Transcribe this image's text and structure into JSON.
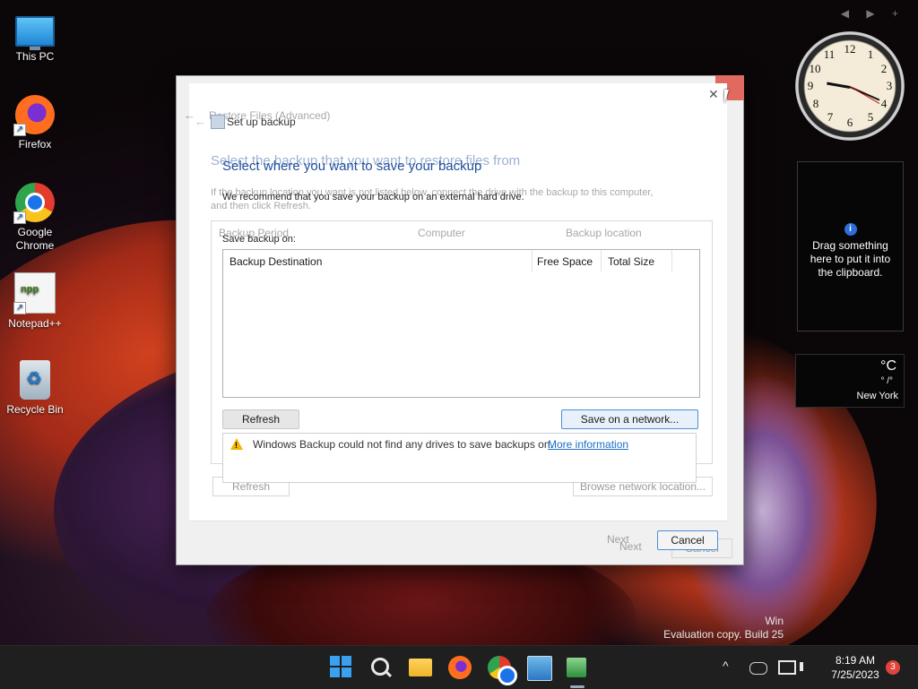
{
  "desktop": {
    "icons": [
      {
        "label": "This PC"
      },
      {
        "label": "Firefox"
      },
      {
        "label": "Google Chrome"
      },
      {
        "label": "Notepad++"
      },
      {
        "label": "Recycle Bin"
      }
    ],
    "gadget_nav": "◀ ▶ +"
  },
  "clock": {
    "numbers": [
      "12",
      "1",
      "2",
      "3",
      "4",
      "5",
      "6",
      "7",
      "8",
      "9",
      "10",
      "11"
    ]
  },
  "clipboard_gadget": {
    "info_glyph": "i",
    "message": "Drag something here to put it into the clipboard."
  },
  "weather_gadget": {
    "unit": "°C",
    "range": "° /°",
    "city": "New York"
  },
  "watermark": {
    "line1": "Win",
    "line2": "Evaluation copy. Build 25"
  },
  "ghost_window": {
    "title": "Restore Files (Advanced)",
    "heading": "Select the backup that you want to restore files from",
    "description": "If the backup location you want is not listed below, connect the drive with the backup to this computer, and then click Refresh.",
    "columns": [
      "Backup Period",
      "Computer",
      "Backup location"
    ],
    "refresh_label": "Refresh",
    "browse_label": "Browse network location...",
    "next_label": "Next",
    "cancel_label": "Cancel"
  },
  "dialog": {
    "title": "Set up backup",
    "heading": "Select where you want to save your backup",
    "recommendation": "We recommend that you save your backup on an external hard drive.",
    "save_on_label": "Save backup on:",
    "table_columns": [
      "Backup Destination",
      "Free Space",
      "Total Size"
    ],
    "refresh_label": "Refresh",
    "save_network_label": "Save on a network...",
    "warning_text": "Windows Backup could not find any drives to save backups on.",
    "more_info_link": "More information",
    "next_label": "Next",
    "cancel_label": "Cancel",
    "close_glyph": "✕"
  },
  "taskbar": {
    "time": "8:19 AM",
    "date": "7/25/2023",
    "notification_count": "3",
    "tray_chevron": "^"
  },
  "colors": {
    "accent": "#2f6ed8",
    "link": "#1a6fc9",
    "heading": "#1f4e9c",
    "warning": "#f2b600"
  }
}
